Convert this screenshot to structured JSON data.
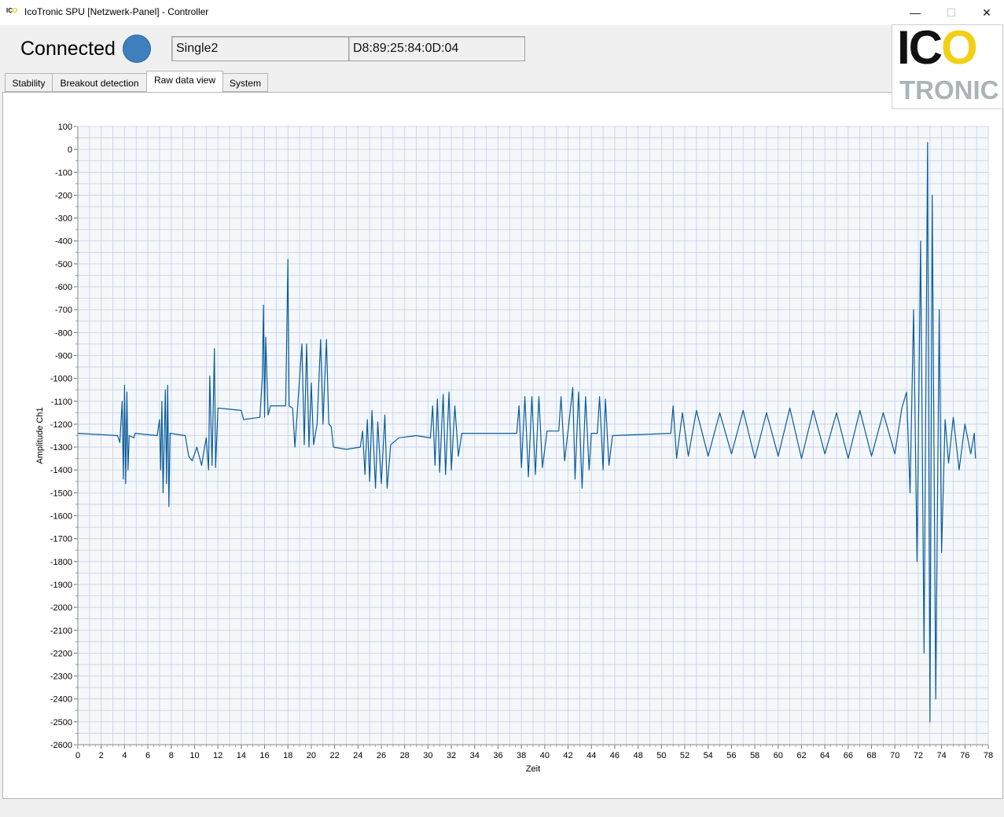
{
  "window": {
    "title": "IcoTronic SPU [Netzwerk-Panel] - Controller",
    "app_icon_text_dark": "IC",
    "app_icon_text_yellow": "O",
    "minimize_icon": "—",
    "maximize_icon": "☐",
    "close_icon": "✕"
  },
  "header": {
    "status_text": "Connected",
    "status_color": "#3e7fbd",
    "device_name": "Single2",
    "mac_address": "D8:89:25:84:0D:04"
  },
  "tabs": [
    {
      "label": "Stability",
      "active": false
    },
    {
      "label": "Breakout detection",
      "active": false
    },
    {
      "label": "Raw data view",
      "active": true
    },
    {
      "label": "System",
      "active": false
    }
  ],
  "logo": {
    "line1_dark": "IC",
    "line1_yellow": "O",
    "line2": "TRONIC",
    "yellow": "#f2cf14",
    "grey": "#a9b5b8"
  },
  "chart_data": {
    "type": "line",
    "xlabel": "Zeit",
    "ylabel": "Amplitude Ch1",
    "xlim": [
      0,
      78
    ],
    "ylim": [
      -2600,
      100
    ],
    "xticks": [
      0,
      2,
      4,
      6,
      8,
      10,
      12,
      14,
      16,
      18,
      20,
      22,
      24,
      26,
      28,
      30,
      32,
      34,
      36,
      38,
      40,
      42,
      44,
      46,
      48,
      50,
      52,
      54,
      56,
      58,
      60,
      62,
      64,
      66,
      68,
      70,
      72,
      74,
      76,
      78
    ],
    "yticks": [
      100,
      0,
      -100,
      -200,
      -300,
      -400,
      -500,
      -600,
      -700,
      -800,
      -900,
      -1000,
      -1100,
      -1200,
      -1300,
      -1400,
      -1500,
      -1600,
      -1700,
      -1800,
      -1900,
      -2000,
      -2100,
      -2200,
      -2300,
      -2400,
      -2500,
      -2600
    ],
    "grid": true,
    "line_color": "#0a5c9a",
    "plot_background": "#f4f8fa",
    "grid_color": "#c6cde6",
    "series": [
      {
        "values": [
          [
            0,
            -1240
          ],
          [
            3.4,
            -1250
          ],
          [
            3.6,
            -1280
          ],
          [
            3.8,
            -1100
          ],
          [
            3.9,
            -1440
          ],
          [
            4.0,
            -1030
          ],
          [
            4.1,
            -1460
          ],
          [
            4.2,
            -1060
          ],
          [
            4.3,
            -1400
          ],
          [
            4.4,
            -1250
          ],
          [
            4.8,
            -1260
          ],
          [
            4.9,
            -1240
          ],
          [
            6.8,
            -1250
          ],
          [
            7.0,
            -1180
          ],
          [
            7.1,
            -1400
          ],
          [
            7.2,
            -1100
          ],
          [
            7.3,
            -1500
          ],
          [
            7.5,
            -1050
          ],
          [
            7.6,
            -1460
          ],
          [
            7.7,
            -1030
          ],
          [
            7.8,
            -1560
          ],
          [
            7.9,
            -1240
          ],
          [
            9.2,
            -1250
          ],
          [
            9.5,
            -1340
          ],
          [
            9.8,
            -1360
          ],
          [
            10.2,
            -1300
          ],
          [
            10.6,
            -1380
          ],
          [
            10.8,
            -1320
          ],
          [
            11.0,
            -1260
          ],
          [
            11.2,
            -1400
          ],
          [
            11.3,
            -990
          ],
          [
            11.5,
            -1380
          ],
          [
            11.7,
            -870
          ],
          [
            11.8,
            -1390
          ],
          [
            12.0,
            -1130
          ],
          [
            14.0,
            -1140
          ],
          [
            14.2,
            -1180
          ],
          [
            15.6,
            -1170
          ],
          [
            15.8,
            -1000
          ],
          [
            15.9,
            -680
          ],
          [
            16.0,
            -1170
          ],
          [
            16.1,
            -820
          ],
          [
            16.3,
            -1160
          ],
          [
            16.5,
            -1120
          ],
          [
            17.8,
            -1120
          ],
          [
            17.9,
            -820
          ],
          [
            18.0,
            -480
          ],
          [
            18.1,
            -1120
          ],
          [
            18.4,
            -1130
          ],
          [
            18.6,
            -1300
          ],
          [
            19.2,
            -850
          ],
          [
            19.4,
            -1290
          ],
          [
            19.6,
            -850
          ],
          [
            19.8,
            -1300
          ],
          [
            20.0,
            -1020
          ],
          [
            20.2,
            -1290
          ],
          [
            20.5,
            -1200
          ],
          [
            20.8,
            -830
          ],
          [
            21.0,
            -1200
          ],
          [
            21.3,
            -830
          ],
          [
            21.5,
            -1200
          ],
          [
            21.7,
            -1210
          ],
          [
            21.9,
            -1300
          ],
          [
            23.0,
            -1310
          ],
          [
            24.2,
            -1300
          ],
          [
            24.4,
            -1230
          ],
          [
            24.6,
            -1420
          ],
          [
            24.8,
            -1180
          ],
          [
            25.0,
            -1450
          ],
          [
            25.2,
            -1140
          ],
          [
            25.5,
            -1480
          ],
          [
            25.7,
            -1190
          ],
          [
            26.0,
            -1460
          ],
          [
            26.3,
            -1160
          ],
          [
            26.5,
            -1480
          ],
          [
            26.8,
            -1290
          ],
          [
            27.5,
            -1260
          ],
          [
            29.0,
            -1250
          ],
          [
            30.2,
            -1260
          ],
          [
            30.4,
            -1120
          ],
          [
            30.6,
            -1380
          ],
          [
            30.8,
            -1090
          ],
          [
            31.0,
            -1410
          ],
          [
            31.3,
            -1070
          ],
          [
            31.5,
            -1420
          ],
          [
            31.8,
            -1060
          ],
          [
            32.0,
            -1400
          ],
          [
            32.3,
            -1120
          ],
          [
            32.6,
            -1340
          ],
          [
            32.9,
            -1240
          ],
          [
            37.6,
            -1240
          ],
          [
            37.8,
            -1120
          ],
          [
            38.0,
            -1390
          ],
          [
            38.3,
            -1080
          ],
          [
            38.6,
            -1430
          ],
          [
            38.9,
            -1080
          ],
          [
            39.2,
            -1420
          ],
          [
            39.5,
            -1080
          ],
          [
            39.8,
            -1390
          ],
          [
            40.2,
            -1230
          ],
          [
            41.2,
            -1230
          ],
          [
            41.4,
            -1080
          ],
          [
            41.7,
            -1360
          ],
          [
            42.0,
            -1230
          ],
          [
            42.4,
            -1040
          ],
          [
            42.6,
            -1440
          ],
          [
            42.9,
            -1060
          ],
          [
            43.2,
            -1480
          ],
          [
            43.5,
            -1080
          ],
          [
            43.8,
            -1400
          ],
          [
            44.0,
            -1240
          ],
          [
            44.5,
            -1240
          ],
          [
            44.7,
            -1080
          ],
          [
            45.0,
            -1400
          ],
          [
            45.2,
            -1090
          ],
          [
            45.5,
            -1380
          ],
          [
            45.8,
            -1250
          ],
          [
            50.8,
            -1240
          ],
          [
            51.0,
            -1120
          ],
          [
            51.3,
            -1350
          ],
          [
            51.8,
            -1150
          ],
          [
            52.3,
            -1340
          ],
          [
            53.0,
            -1140
          ],
          [
            54.0,
            -1340
          ],
          [
            55.0,
            -1150
          ],
          [
            56.0,
            -1330
          ],
          [
            57.0,
            -1140
          ],
          [
            58.0,
            -1350
          ],
          [
            59.0,
            -1150
          ],
          [
            60.0,
            -1340
          ],
          [
            61.0,
            -1130
          ],
          [
            62.0,
            -1350
          ],
          [
            63.0,
            -1140
          ],
          [
            64.0,
            -1330
          ],
          [
            65.0,
            -1150
          ],
          [
            66.0,
            -1350
          ],
          [
            67.0,
            -1140
          ],
          [
            68.0,
            -1340
          ],
          [
            69.0,
            -1150
          ],
          [
            70.0,
            -1330
          ],
          [
            70.6,
            -1130
          ],
          [
            71.0,
            -1060
          ],
          [
            71.3,
            -1500
          ],
          [
            71.6,
            -700
          ],
          [
            71.9,
            -1800
          ],
          [
            72.2,
            -400
          ],
          [
            72.5,
            -2200
          ],
          [
            72.8,
            30
          ],
          [
            73.0,
            -2500
          ],
          [
            73.2,
            -200
          ],
          [
            73.5,
            -2400
          ],
          [
            73.8,
            -700
          ],
          [
            74.0,
            -1760
          ],
          [
            74.3,
            -1180
          ],
          [
            74.6,
            -1370
          ],
          [
            75.0,
            -1170
          ],
          [
            75.5,
            -1400
          ],
          [
            76.0,
            -1200
          ],
          [
            76.5,
            -1330
          ],
          [
            76.8,
            -1240
          ],
          [
            76.9,
            -1350
          ]
        ]
      }
    ]
  }
}
